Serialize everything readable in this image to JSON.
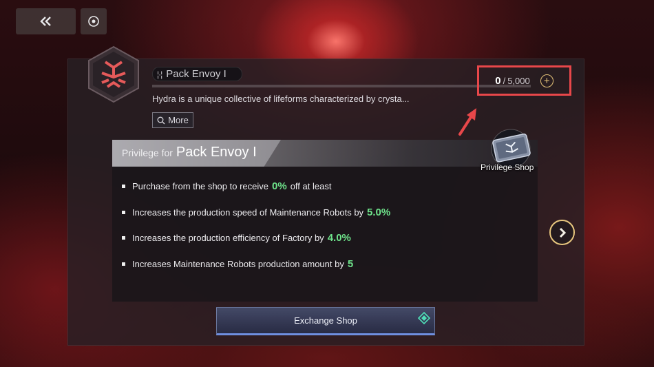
{
  "nav": {
    "back_icon": "double-chevron-left-icon",
    "target_icon": "target-icon"
  },
  "pack": {
    "name": "Pack Envoy I",
    "description": "Hydra is a unique collective of lifeforms characterized by crysta...",
    "more_label": "More",
    "progress": {
      "current": "0",
      "separator": "/",
      "max": "5,000",
      "fraction": 0
    }
  },
  "privilege": {
    "header_label": "Privilege for",
    "header_name": "Pack Envoy I",
    "items": [
      {
        "text": "Purchase from the shop to receive",
        "value": "0%",
        "suffix": "off at least"
      },
      {
        "text": "Increases the production speed of Maintenance Robots by",
        "value": "5.0%",
        "suffix": ""
      },
      {
        "text": "Increases the production efficiency of Factory by",
        "value": "4.0%",
        "suffix": ""
      },
      {
        "text": "Increases Maintenance Robots production amount by",
        "value": "5",
        "suffix": ""
      }
    ]
  },
  "privilege_shop": {
    "label": "Privilege Shop"
  },
  "exchange_button": {
    "label": "Exchange Shop"
  },
  "colors": {
    "highlight_box": "#e8474a",
    "value_green": "#6ee28a",
    "accent_gold": "#e8c67a"
  }
}
